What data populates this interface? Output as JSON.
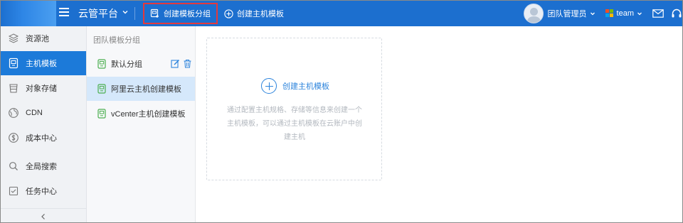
{
  "topbar": {
    "brand": "云管平台",
    "create_group_label": "创建模板分组",
    "create_template_label": "创建主机模板",
    "user_name": "团队管理员",
    "team_name": "team"
  },
  "sidebar": {
    "items": [
      {
        "label": "资源池",
        "icon": "stack-icon"
      },
      {
        "label": "主机模板",
        "icon": "host-template-icon"
      },
      {
        "label": "对象存储",
        "icon": "bucket-icon"
      },
      {
        "label": "CDN",
        "icon": "globe-icon"
      },
      {
        "label": "成本中心",
        "icon": "dollar-icon"
      },
      {
        "label": "全局搜索",
        "icon": "search-icon"
      },
      {
        "label": "任务中心",
        "icon": "task-icon"
      }
    ],
    "active_index": 1
  },
  "group_panel": {
    "heading": "团队模板分组",
    "items": [
      {
        "label": "默认分组"
      },
      {
        "label": "阿里云主机创建模板"
      },
      {
        "label": "vCenter主机创建模板"
      }
    ],
    "selected_index": 1
  },
  "main": {
    "add_label": "创建主机模板",
    "description": "通过配置主机规格、存储等信息来创建一个主机模板，可以通过主机模板在云账户中创建主机"
  },
  "colors": {
    "topbar": "#1c6fcf",
    "accent": "#1c7ad9",
    "highlight_border": "#e4393c",
    "icon_green": "#4caf50"
  }
}
